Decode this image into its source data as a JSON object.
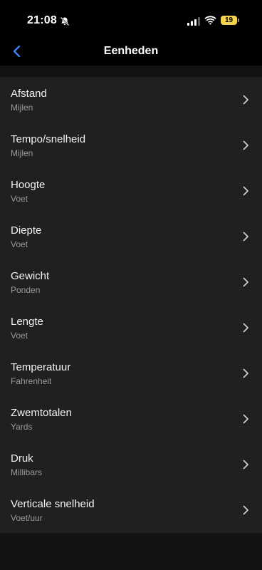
{
  "status_bar": {
    "time": "21:08",
    "battery_level": "19",
    "icons": [
      "bell-slash-icon",
      "signal-icon",
      "wifi-icon",
      "battery-icon"
    ],
    "battery_color": "#f4d44d"
  },
  "nav": {
    "back_icon": "chevron-left-icon",
    "title": "Eenheden",
    "accent_color": "#3a7ff6"
  },
  "units": [
    {
      "label": "Afstand",
      "value": "Mijlen"
    },
    {
      "label": "Tempo/snelheid",
      "value": "Mijlen"
    },
    {
      "label": "Hoogte",
      "value": "Voet"
    },
    {
      "label": "Diepte",
      "value": "Voet"
    },
    {
      "label": "Gewicht",
      "value": "Ponden"
    },
    {
      "label": "Lengte",
      "value": "Voet"
    },
    {
      "label": "Temperatuur",
      "value": "Fahrenheit"
    },
    {
      "label": "Zwemtotalen",
      "value": "Yards"
    },
    {
      "label": "Druk",
      "value": "Millibars"
    },
    {
      "label": "Verticale snelheid",
      "value": "Voet/uur"
    }
  ]
}
